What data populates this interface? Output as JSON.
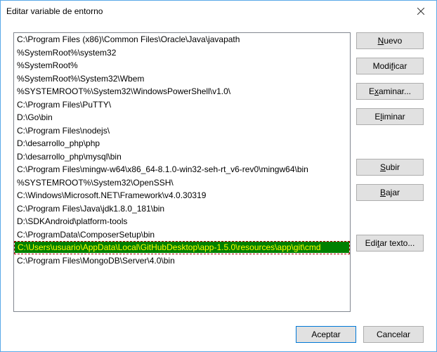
{
  "window": {
    "title": "Editar variable de entorno"
  },
  "list": {
    "selectedIndex": 16,
    "items": [
      "C:\\Program Files (x86)\\Common Files\\Oracle\\Java\\javapath",
      "%SystemRoot%\\system32",
      "%SystemRoot%",
      "%SystemRoot%\\System32\\Wbem",
      "%SYSTEMROOT%\\System32\\WindowsPowerShell\\v1.0\\",
      "C:\\Program Files\\PuTTY\\",
      "D:\\Go\\bin",
      "C:\\Program Files\\nodejs\\",
      "D:\\desarrollo_php\\php",
      "D:\\desarrollo_php\\mysql\\bin",
      "C:\\Program Files\\mingw-w64\\x86_64-8.1.0-win32-seh-rt_v6-rev0\\mingw64\\bin",
      "%SYSTEMROOT%\\System32\\OpenSSH\\",
      "C:\\Windows\\Microsoft.NET\\Framework\\v4.0.30319",
      "C:\\Program Files\\Java\\jdk1.8.0_181\\bin",
      "D:\\SDKAndroid\\platform-tools",
      "C:\\ProgramData\\ComposerSetup\\bin",
      "C:\\Users\\usuario\\AppData\\Local\\GitHubDesktop\\app-1.5.0\\resources\\app\\git\\cmd",
      "C:\\Program Files\\MongoDB\\Server\\4.0\\bin"
    ]
  },
  "buttons": {
    "new_pre": "",
    "new_u": "N",
    "new_post": "uevo",
    "edit_pre": "Modi",
    "edit_u": "f",
    "edit_post": "icar",
    "browse_pre": "E",
    "browse_u": "x",
    "browse_post": "aminar...",
    "delete_pre": "E",
    "delete_u": "l",
    "delete_post": "iminar",
    "up_pre": "",
    "up_u": "S",
    "up_post": "ubir",
    "down_pre": "",
    "down_u": "B",
    "down_post": "ajar",
    "edit_text_pre": "Edi",
    "edit_text_u": "t",
    "edit_text_post": "ar texto...",
    "ok": "Aceptar",
    "cancel": "Cancelar"
  }
}
